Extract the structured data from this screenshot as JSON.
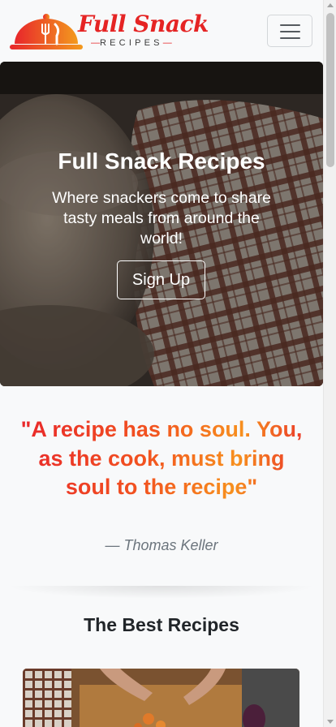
{
  "navbar": {
    "brand": {
      "title": "Full Snack",
      "subtitle": "RECIPES"
    },
    "menu_icon": "hamburger-menu-icon"
  },
  "hero": {
    "title": "Full Snack Recipes",
    "text": "Where snackers come to share tasty meals from around the world!",
    "button_label": "Sign Up"
  },
  "quote": {
    "text": "\"A recipe has no soul. You, as the cook, must bring soul to the recipe\"",
    "author": "— Thomas Keller"
  },
  "recipes_section": {
    "title": "The Best Recipes"
  },
  "colors": {
    "brand_red": "#e52424",
    "brand_orange": "#f7901e",
    "background": "#f8f9fa"
  }
}
